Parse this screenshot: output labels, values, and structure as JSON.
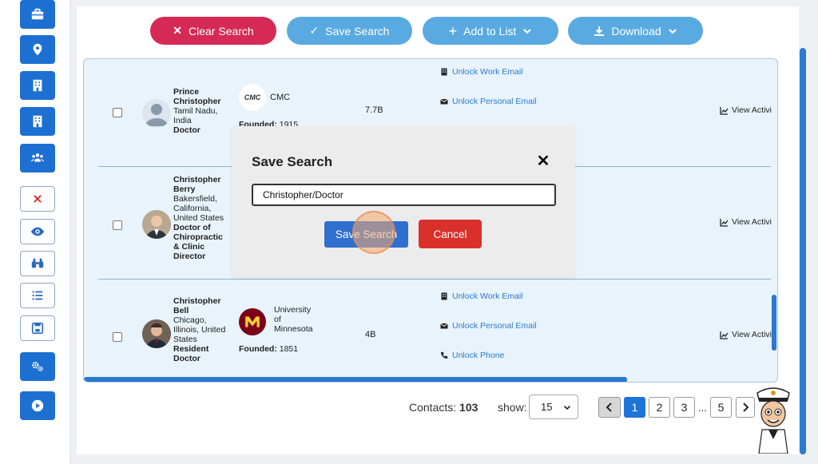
{
  "sidebar": {
    "icons": [
      "briefcase-icon",
      "location-pin-icon",
      "building-icon",
      "building-icon",
      "users-icon",
      "close-icon",
      "eye-icon",
      "binoculars-icon",
      "list-icon",
      "save-icon",
      "settings-icon",
      "play-icon"
    ]
  },
  "toolbar": {
    "clear_label": "Clear Search",
    "save_label": "Save Search",
    "add_label": "Add to List",
    "download_label": "Download"
  },
  "rows": [
    {
      "name": "Prince Christopher",
      "location": "Tamil Nadu, India",
      "title": "Doctor",
      "company": "CMC",
      "company_logo_text": "CMC",
      "founded_label": "Founded:",
      "founded": "1915",
      "metric": "7.7B",
      "unlock_work": "Unlock Work Email",
      "unlock_personal": "Unlock Personal Email",
      "activity": "View Activi"
    },
    {
      "name": "Christopher Berry",
      "location": "Bakersfield, California, United States",
      "title": "Doctor of Chiropractic & Clinic Director",
      "activity": "View Activi"
    },
    {
      "name": "Christopher Bell",
      "location": "Chicago, Illinois, United States",
      "title": "Resident Doctor",
      "company": "University of Minnesota",
      "founded_label": "Founded:",
      "founded": "1851",
      "metric": "4B",
      "unlock_work": "Unlock Work Email",
      "unlock_personal": "Unlock Personal Email",
      "unlock_phone": "Unlock Phone",
      "activity": "View Activi"
    }
  ],
  "modal": {
    "title": "Save Search",
    "input_value": "Christopher/Doctor",
    "save_label": "Save Search",
    "cancel_label": "Cancel"
  },
  "pagination": {
    "contacts_label": "Contacts:",
    "contacts_count": "103",
    "show_label": "show:",
    "show_value": "15",
    "pages": [
      "1",
      "2",
      "3",
      "5"
    ],
    "ellipsis": "...",
    "current_page": "1"
  },
  "colors": {
    "primary": "#1d6fd1",
    "clear": "#d42a55",
    "secondary": "#5aaae2",
    "cancel": "#d9302c"
  }
}
